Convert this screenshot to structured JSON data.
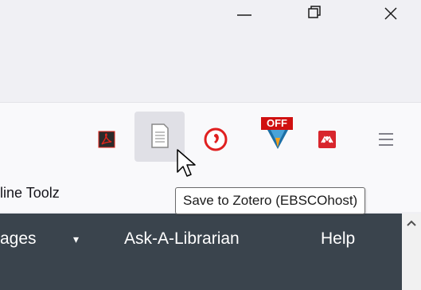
{
  "window": {
    "minimize_icon": "minimize-icon",
    "restore_icon": "restore-icon",
    "close_icon": "close-icon"
  },
  "toolbar": {
    "extensions": [
      {
        "name": "adobe-acrobat-icon",
        "color": "#e1251b"
      },
      {
        "name": "zotero-save-icon",
        "color": "#888888"
      },
      {
        "name": "red-circle-icon",
        "color": "#e02020"
      },
      {
        "name": "off-badge-icon",
        "badge": "OFF",
        "color": "#d01010"
      },
      {
        "name": "mendeley-icon",
        "color": "#d8262d"
      },
      {
        "name": "hamburger-menu-icon",
        "color": "#5b5b66"
      }
    ]
  },
  "bookmarks": {
    "partial_item": "line Toolz"
  },
  "tooltip": {
    "text": "Save to Zotero (EBSCOhost)"
  },
  "page": {
    "nav": {
      "item1": "ages",
      "item1_caret": "▾",
      "item2": "Ask-A-Librarian",
      "item3": "Help"
    },
    "bg_color": "#3a444d"
  }
}
